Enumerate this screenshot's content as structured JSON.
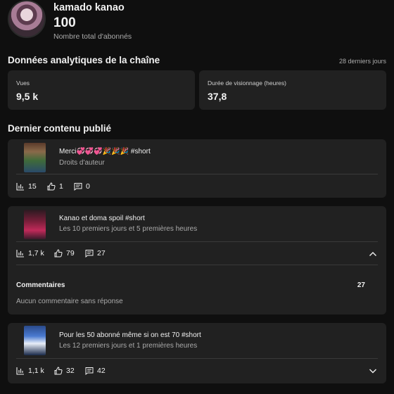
{
  "channel": {
    "name": "kamado kanao",
    "subscriber_count": "100",
    "subscriber_label": "Nombre total d'abonnés"
  },
  "analytics": {
    "title": "Données analytiques de la chaîne",
    "period": "28 derniers jours",
    "metrics": [
      {
        "label": "Vues",
        "value": "9,5 k"
      },
      {
        "label": "Durée de visionnage (heures)",
        "value": "37,8"
      }
    ]
  },
  "latest": {
    "title": "Dernier contenu publié",
    "videos": [
      {
        "title": "Merci💞💞💞🎉🎉🎉       #short",
        "subtitle": "Droits d'auteur",
        "views": "15",
        "likes": "1",
        "comments": "0"
      },
      {
        "title": "Kanao et doma spoil  #short",
        "subtitle": "Les 10 premiers jours et 5 premières heures",
        "views": "1,7 k",
        "likes": "79",
        "comments": "27",
        "expanded": true,
        "comments_section": {
          "label": "Commentaires",
          "count": "27",
          "empty_text": "Aucun commentaire sans réponse"
        }
      },
      {
        "title": "Pour les 50 abonné même si on est 70  #short",
        "subtitle": "Les 12 premiers jours et 1 premières heures",
        "views": "1,1 k",
        "likes": "32",
        "comments": "42",
        "expanded": false
      }
    ]
  },
  "icons": {
    "views": "bar-chart-icon",
    "likes": "thumbs-up-icon",
    "comments": "comment-icon",
    "expand": "chevron-icon"
  },
  "colors": {
    "background": "#0f0f0f",
    "card": "#212121",
    "text": "#f1f1f1",
    "secondary": "#aaaaaa"
  }
}
